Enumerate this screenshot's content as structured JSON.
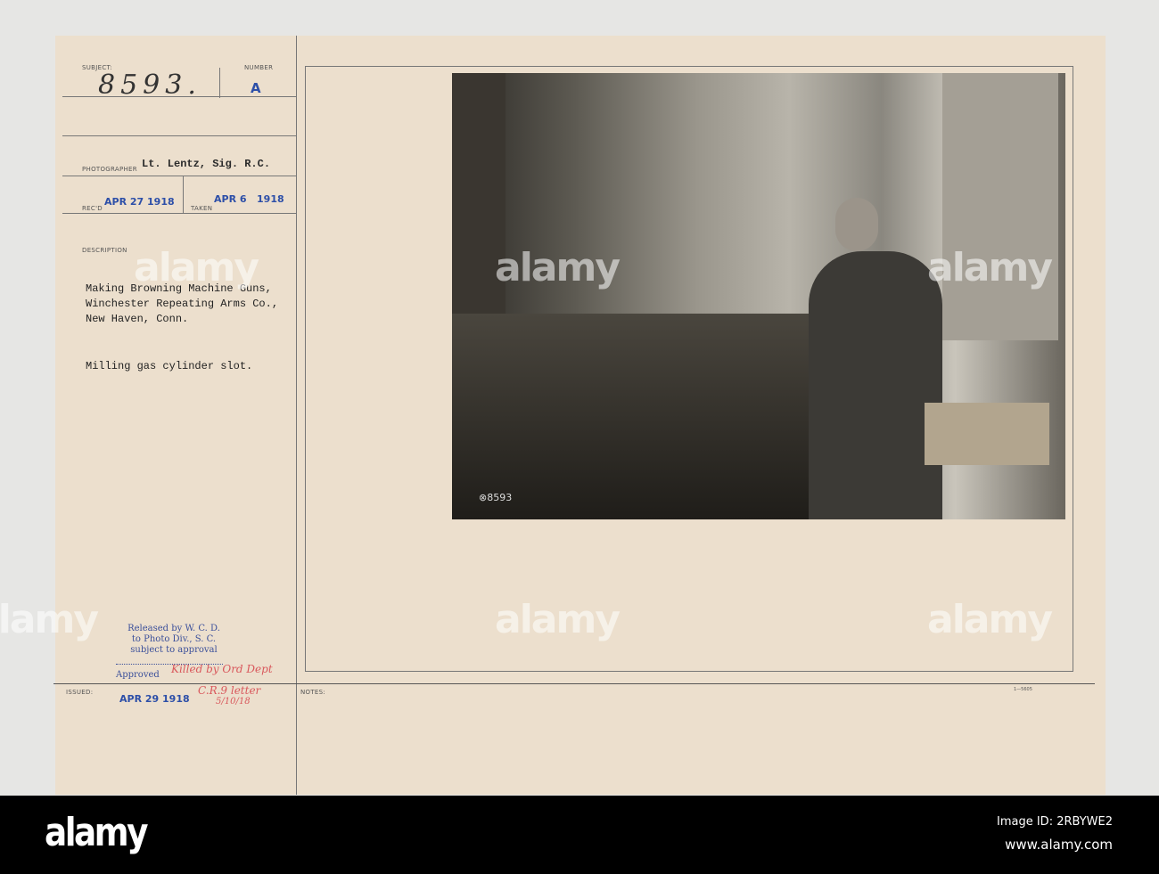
{
  "card": {
    "subject_label": "SUBJECT:",
    "subject": "8593.",
    "number_label": "NUMBER",
    "number": "A",
    "photographer_label": "PHOTOGRAPHER",
    "photographer": "Lt. Lentz, Sig. R.C.",
    "recd_label": "REC'D",
    "recd": "APR 27 1918",
    "taken_label": "TAKEN",
    "taken": "APR 6   1918",
    "description_label": "DESCRIPTION",
    "description": [
      "Making Browning Machine Guns,",
      "Winchester Repeating Arms Co.,",
      "New Haven, Conn."
    ],
    "caption": "Milling gas cylinder slot.",
    "release": [
      "Released by W. C. D.",
      "to Photo Div., S. C.",
      "subject to approval"
    ],
    "approved_label": "Approved",
    "handwritten": [
      "Killed by Ord Dept",
      "C.R.9 letter",
      "5/10/18"
    ],
    "issued_label": "ISSUED:",
    "issued": "APR 29 1918",
    "notes_label": "NOTES:",
    "form_number": "1—5605",
    "photo_mark": "⊗8593"
  },
  "watermark": "alamy",
  "footer": {
    "logo": "alamy",
    "image_id": "Image ID: 2RBYWE2",
    "url": "www.alamy.com"
  }
}
